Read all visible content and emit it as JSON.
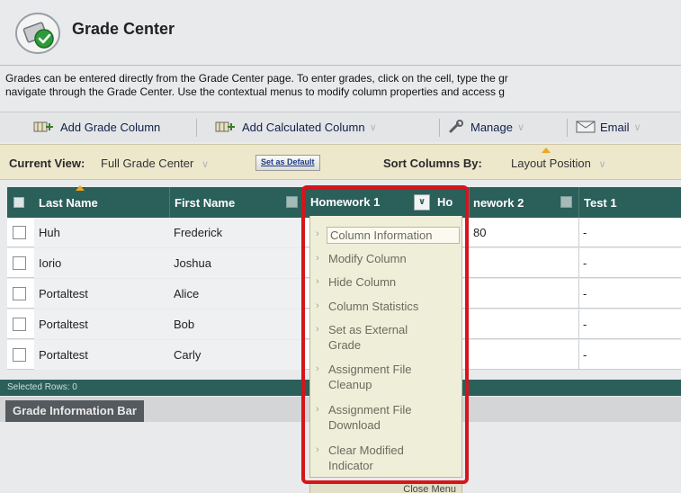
{
  "page": {
    "title": "Grade Center",
    "description_line1": "Grades can be entered directly from the Grade Center page. To enter grades, click on the cell, type the gr",
    "description_line2": "navigate through the Grade Center. Use the contextual menus to modify column properties and access g"
  },
  "action_bar": {
    "add_grade_column": "Add Grade Column",
    "add_calculated_column": "Add Calculated Column",
    "manage": "Manage",
    "email": "Email"
  },
  "view_bar": {
    "current_view_label": "Current View:",
    "current_view_value": "Full Grade Center",
    "set_as_default": "Set as Default",
    "sort_label": "Sort Columns By:",
    "sort_value": "Layout Position"
  },
  "grid": {
    "headers": {
      "last_name": "Last Name",
      "first_name": "First Name",
      "homework1": "Homework 1",
      "homework2_partial": "nework 2",
      "homework2_prefix": "Ho",
      "test1": "Test 1"
    },
    "rows": [
      {
        "last": "Huh",
        "first": "Frederick",
        "hw2": "80",
        "test1": "-"
      },
      {
        "last": "Iorio",
        "first": "Joshua",
        "hw2": "",
        "test1": "-"
      },
      {
        "last": "Portaltest",
        "first": "Alice",
        "hw2": "",
        "test1": "-"
      },
      {
        "last": "Portaltest",
        "first": "Bob",
        "hw2": "",
        "test1": "-"
      },
      {
        "last": "Portaltest",
        "first": "Carly",
        "hw2": "",
        "test1": "-"
      }
    ],
    "selected_rows": "Selected Rows: 0"
  },
  "info_bar": {
    "label": "Grade Information Bar"
  },
  "context_menu": {
    "items": [
      {
        "label": "Column Information"
      },
      {
        "label": "Modify Column"
      },
      {
        "label": "Hide Column"
      },
      {
        "label": "Column Statistics"
      },
      {
        "label": "Set as External Grade"
      },
      {
        "label": "Assignment File Cleanup"
      },
      {
        "label": "Assignment File Download"
      },
      {
        "label": "Clear Modified Indicator"
      }
    ],
    "close_label": "Close Menu"
  },
  "colors": {
    "header_teal": "#2a5f5a",
    "highlight_red": "#d4161c",
    "menu_bg": "#efeed9",
    "view_bar_bg": "#ede7cc"
  }
}
